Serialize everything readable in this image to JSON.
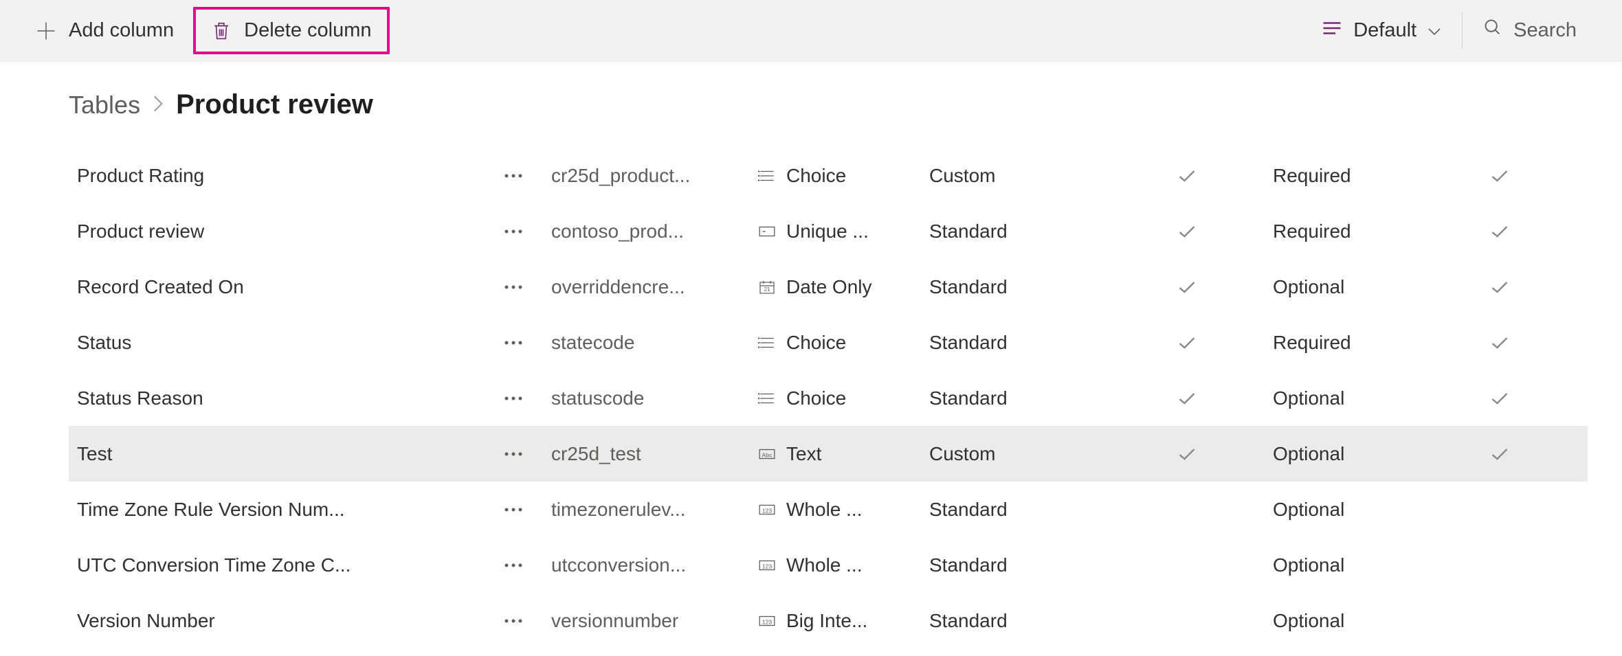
{
  "toolbar": {
    "add_column_label": "Add column",
    "delete_column_label": "Delete column",
    "view_label": "Default",
    "search_placeholder": "Search"
  },
  "breadcrumb": {
    "root": "Tables",
    "current": "Product review"
  },
  "rows": [
    {
      "name": "Product Rating",
      "schema": "cr25d_product...",
      "type_icon": "choice",
      "type": "Choice",
      "kind": "Custom",
      "check1": true,
      "required": "Required",
      "check2": true,
      "selected": false
    },
    {
      "name": "Product review",
      "schema": "contoso_prod...",
      "type_icon": "unique",
      "type": "Unique ...",
      "kind": "Standard",
      "check1": true,
      "required": "Required",
      "check2": true,
      "selected": false
    },
    {
      "name": "Record Created On",
      "schema": "overriddencre...",
      "type_icon": "date",
      "type": "Date Only",
      "kind": "Standard",
      "check1": true,
      "required": "Optional",
      "check2": true,
      "selected": false
    },
    {
      "name": "Status",
      "schema": "statecode",
      "type_icon": "choice",
      "type": "Choice",
      "kind": "Standard",
      "check1": true,
      "required": "Required",
      "check2": true,
      "selected": false
    },
    {
      "name": "Status Reason",
      "schema": "statuscode",
      "type_icon": "choice",
      "type": "Choice",
      "kind": "Standard",
      "check1": true,
      "required": "Optional",
      "check2": true,
      "selected": false
    },
    {
      "name": "Test",
      "schema": "cr25d_test",
      "type_icon": "text",
      "type": "Text",
      "kind": "Custom",
      "check1": true,
      "required": "Optional",
      "check2": true,
      "selected": true
    },
    {
      "name": "Time Zone Rule Version Num...",
      "schema": "timezonerulev...",
      "type_icon": "whole",
      "type": "Whole ...",
      "kind": "Standard",
      "check1": false,
      "required": "Optional",
      "check2": false,
      "selected": false
    },
    {
      "name": "UTC Conversion Time Zone C...",
      "schema": "utcconversion...",
      "type_icon": "whole",
      "type": "Whole ...",
      "kind": "Standard",
      "check1": false,
      "required": "Optional",
      "check2": false,
      "selected": false
    },
    {
      "name": "Version Number",
      "schema": "versionnumber",
      "type_icon": "bigint",
      "type": "Big Inte...",
      "kind": "Standard",
      "check1": false,
      "required": "Optional",
      "check2": false,
      "selected": false
    }
  ]
}
